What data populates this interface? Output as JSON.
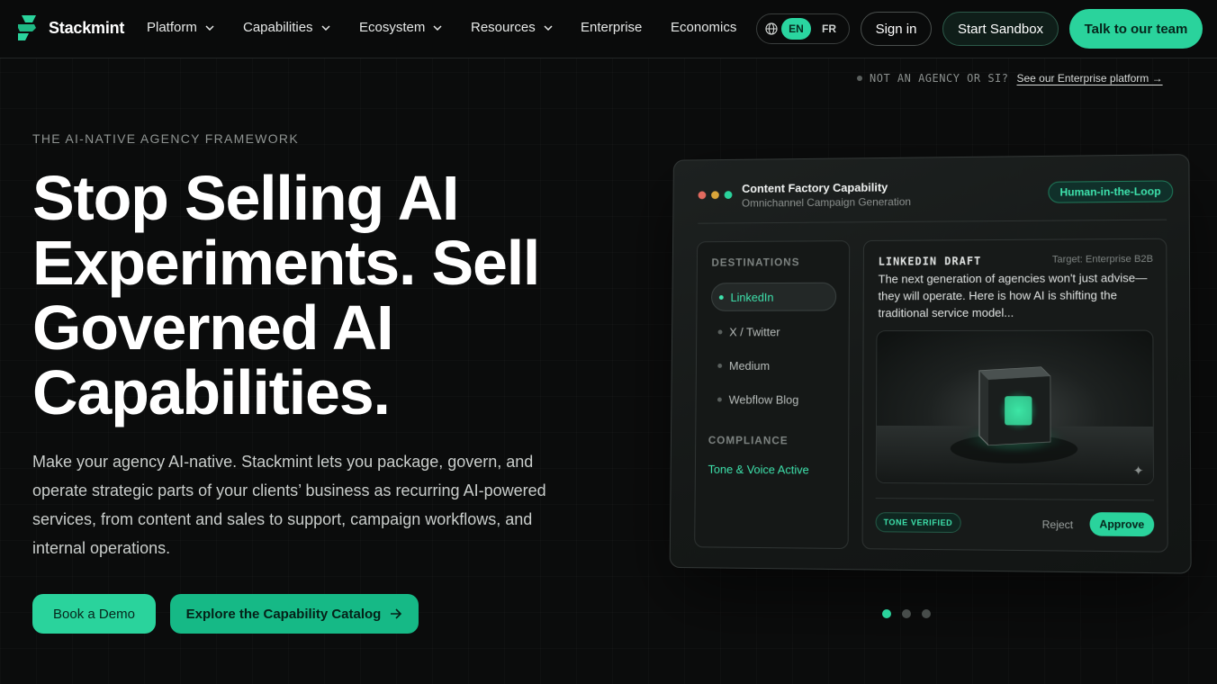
{
  "brand": {
    "name": "Stackmint",
    "accent": "#2ad39c"
  },
  "nav": {
    "items": [
      {
        "label": "Platform",
        "has_menu": true
      },
      {
        "label": "Capabilities",
        "has_menu": true
      },
      {
        "label": "Ecosystem",
        "has_menu": true
      },
      {
        "label": "Resources",
        "has_menu": true
      },
      {
        "label": "Enterprise",
        "has_menu": false
      },
      {
        "label": "Economics",
        "has_menu": false
      }
    ],
    "lang": {
      "active": "EN",
      "other": "FR"
    },
    "sign_in": "Sign in",
    "sandbox": "Start Sandbox",
    "talk": "Talk to our team"
  },
  "notice": {
    "text": "NOT AN AGENCY OR SI?",
    "link": "See our Enterprise platform →"
  },
  "hero": {
    "eyebrow": "THE AI-NATIVE AGENCY FRAMEWORK",
    "headline": "Stop Selling AI Experiments. Sell Governed AI Capabilities.",
    "subcopy": "Make your agency AI-native. Stackmint lets you package, govern, and operate strategic parts of your clients’ business as recurring AI-powered services, from content and sales to support, campaign workflows, and internal operations.",
    "cta_primary": "Book a Demo",
    "cta_secondary": "Explore the Capability Catalog"
  },
  "mock": {
    "title": "Content Factory Capability",
    "subtitle": "Omnichannel Campaign Generation",
    "badge": "Human-in-the-Loop",
    "destinations_label": "DESTINATIONS",
    "destinations": [
      "LinkedIn",
      "X / Twitter",
      "Medium",
      "Webflow Blog"
    ],
    "compliance_label": "COMPLIANCE",
    "compliance_value": "Tone & Voice Active",
    "draft": {
      "label": "LINKEDIN DRAFT",
      "target": "Target: Enterprise B2B",
      "text": "The next generation of agencies won't just advise—they will operate. Here is how AI is shifting the traditional service model...",
      "tone_badge": "TONE VERIFIED",
      "reject": "Reject",
      "approve": "Approve"
    }
  },
  "carousel": {
    "slides": 3,
    "active": 1
  }
}
